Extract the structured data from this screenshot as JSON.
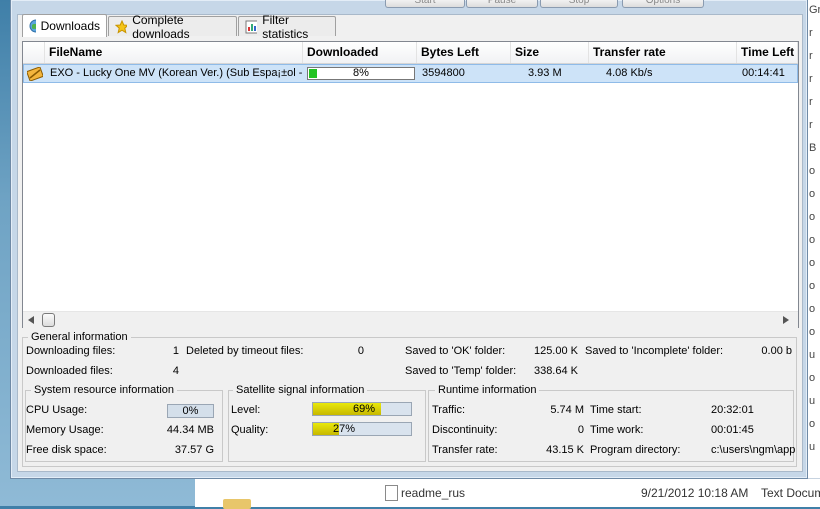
{
  "top_buttons": [
    "Start",
    "Pause",
    "Stop",
    "Options"
  ],
  "tabs": [
    {
      "label": "Downloads",
      "icon": "globe-icon",
      "active": true
    },
    {
      "label": "Complete downloads",
      "icon": "star-icon",
      "active": false
    },
    {
      "label": "Filter statistics",
      "icon": "chart-icon",
      "active": false
    }
  ],
  "columns": [
    "FileName",
    "Downloaded",
    "Bytes Left",
    "Size",
    "Transfer rate",
    "Time Left"
  ],
  "rows": [
    {
      "file": "EXO - Lucky One MV (Korean Ver.) (Sub Espa¡±ol -",
      "progress_text": "8%",
      "progress": 8,
      "bytes_left": "3594800",
      "size": "3.93 M",
      "rate": "4.08 Kb/s",
      "time_left": "00:14:41"
    }
  ],
  "general": {
    "title": "General information",
    "downloading_label": "Downloading files:",
    "downloading_value": "1",
    "timeout_label": "Deleted by timeout files:",
    "timeout_value": "0",
    "ok_label": "Saved to 'OK' folder:",
    "ok_value": "125.00 K",
    "incomplete_label": "Saved to 'Incomplete' folder:",
    "incomplete_value": "0.00 b",
    "downloaded_label": "Downloaded files:",
    "downloaded_value": "4",
    "temp_label": "Saved to 'Temp' folder:",
    "temp_value": "338.64 K"
  },
  "system": {
    "title": "System resource information",
    "cpu_label": "CPU Usage:",
    "cpu_value": "0%",
    "mem_label": "Memory Usage:",
    "mem_value": "44.34 MB",
    "disk_label": "Free disk space:",
    "disk_value": "37.57 G"
  },
  "satellite": {
    "title": "Satellite signal information",
    "level_label": "Level:",
    "level_text": "69%",
    "level": 69,
    "quality_label": "Quality:",
    "quality_text": "27%",
    "quality": 27
  },
  "runtime": {
    "title": "Runtime information",
    "traffic_label": "Traffic:",
    "traffic_value": "5.74 M",
    "start_label": "Time start:",
    "start_value": "20:32:01",
    "disc_label": "Discontinuity:",
    "disc_value": "0",
    "work_label": "Time work:",
    "work_value": "00:01:45",
    "rate_label": "Transfer rate:",
    "rate_value": "43.15 K",
    "dir_label": "Program directory:",
    "dir_value": "c:\\users\\ngm\\app"
  },
  "background": {
    "file_name": "readme_rus",
    "file_date": "9/21/2012 10:18 AM",
    "file_type": "Text Docum",
    "right_chars": [
      "Gr",
      "r",
      "r",
      "r",
      "r",
      "r",
      "B",
      "o",
      "o",
      "o",
      "o",
      "o",
      "o",
      "o",
      "o",
      "u",
      "o",
      "u",
      "o",
      "u"
    ]
  }
}
